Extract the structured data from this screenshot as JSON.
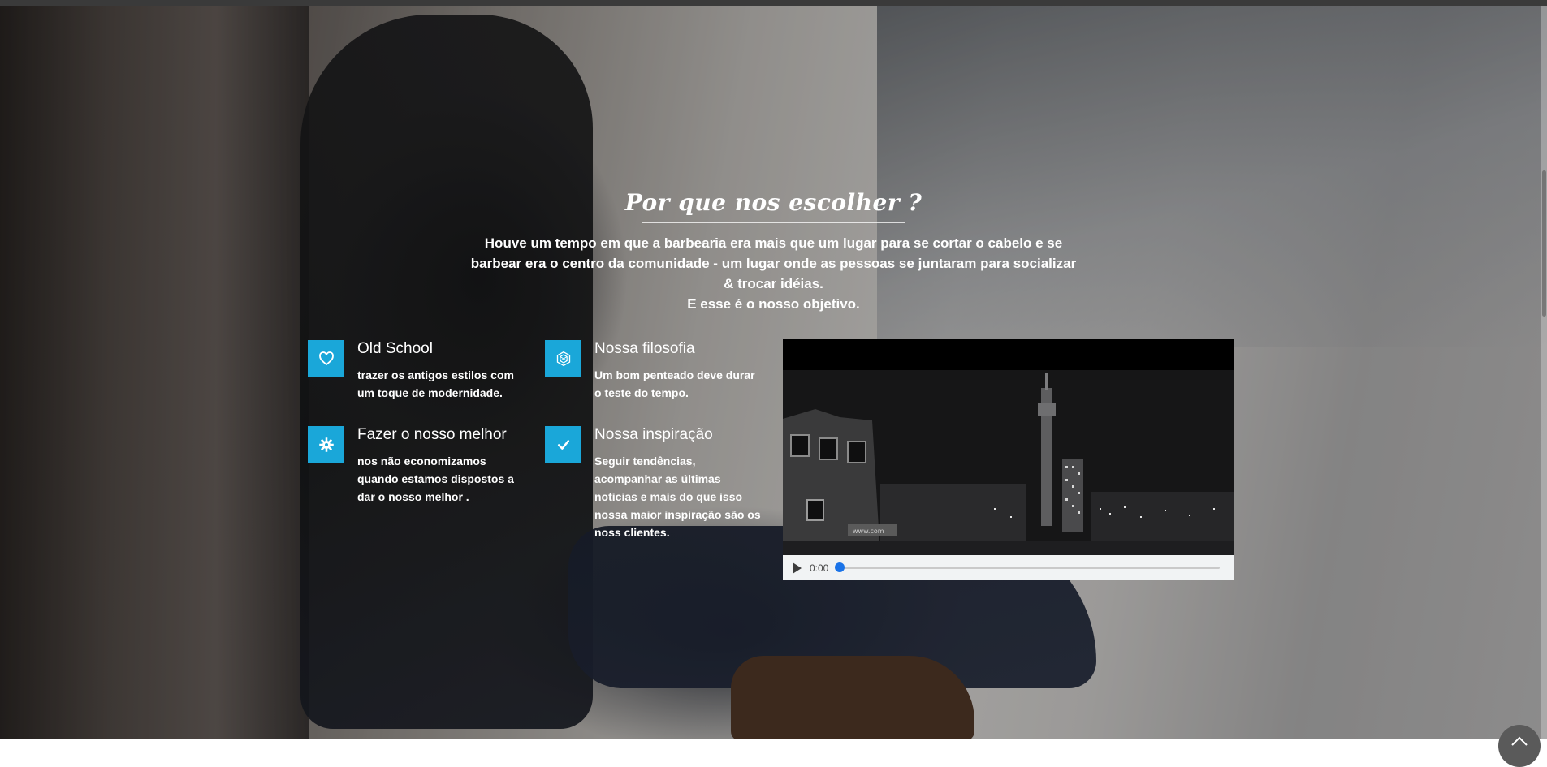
{
  "section": {
    "title": "Por que nos escolher ?",
    "intro_lines": [
      "Houve um tempo em que a barbearia era mais que um lugar para se cortar o cabelo e se",
      "barbear era o centro da comunidade - um lugar onde as pessoas se juntaram para socializar",
      "& trocar idéias.",
      "E esse é o nosso objetivo."
    ]
  },
  "features": [
    {
      "icon": "heart-icon",
      "title": "Old School",
      "text": "trazer os antigos estilos com um toque de modernidade."
    },
    {
      "icon": "hexagon-icon",
      "title": "Nossa filosofia",
      "text": "Um bom penteado deve durar o teste do tempo."
    },
    {
      "icon": "gear-icon",
      "title": "Fazer o nosso melhor",
      "text": "nos não economizamos quando estamos dispostos a dar o nosso melhor ."
    },
    {
      "icon": "check-icon",
      "title": "Nossa inspiração",
      "text": "Seguir tendências, acompanhar as últimas noticias e mais do que isso nossa maior inspiração são os noss clientes."
    }
  ],
  "video": {
    "current_time": "0:00",
    "progress": 0,
    "banner_text": "www.com"
  },
  "colors": {
    "accent": "#1aa7d9",
    "text": "#ffffff",
    "controls_bg": "#f1f3f4",
    "seek_knob": "#1a73e8"
  }
}
